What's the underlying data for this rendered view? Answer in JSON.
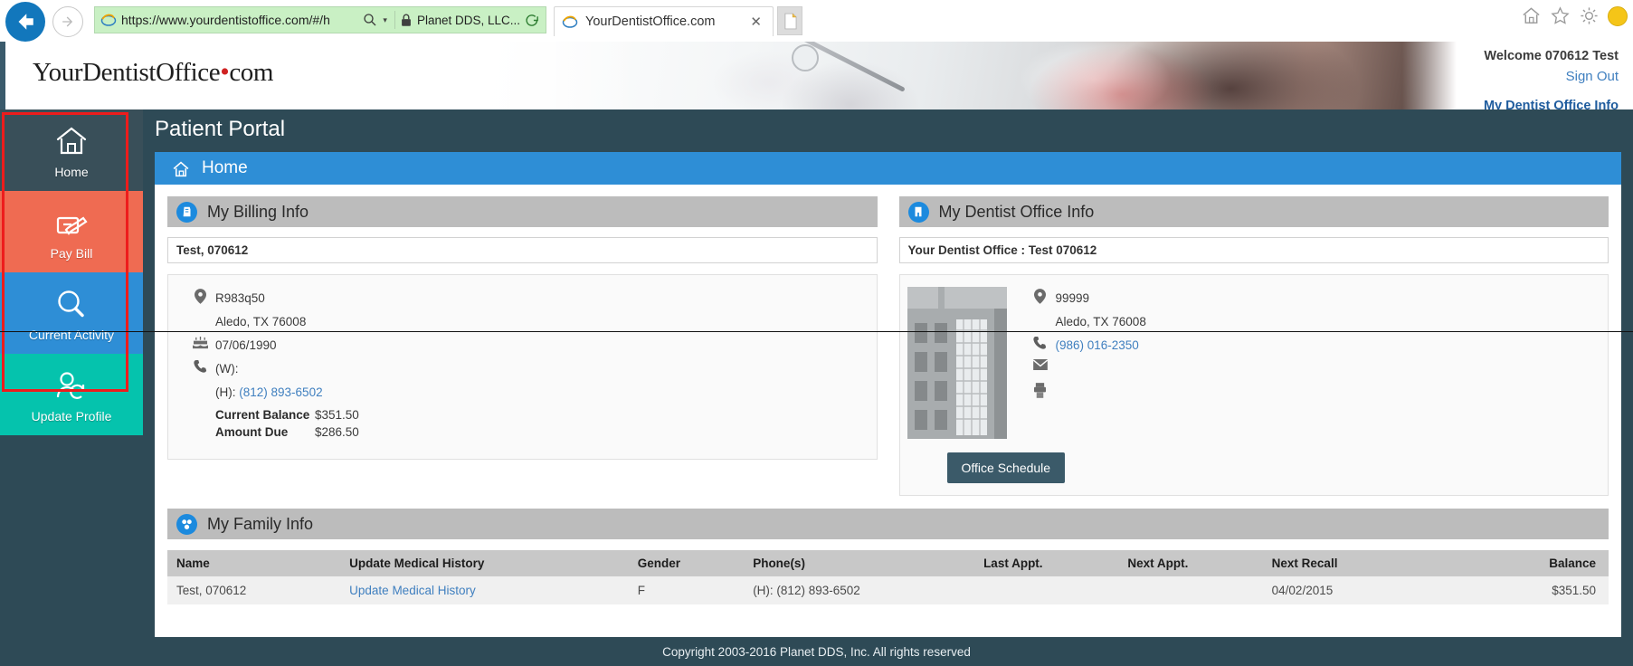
{
  "browser": {
    "back_icon": "back-arrow-icon",
    "forward_icon": "forward-arrow-icon",
    "url": "https://www.yourdentistoffice.com/#/h",
    "url_prefix": "https://www.",
    "url_domain": "yourdentistoffice.com",
    "url_path": "/#/h",
    "search_icon": "search-icon",
    "dropdown_caret": "▾",
    "lock_icon": "lock-icon",
    "cert_name": "Planet DDS, LLC...",
    "refresh_icon": "refresh-icon",
    "tab_title": "YourDentistOffice.com",
    "tab_close": "✕",
    "new_tab_icon": "new-tab-icon",
    "home_icon": "home-icon",
    "favorites_icon": "star-icon",
    "settings_icon": "gear-icon"
  },
  "header": {
    "logo_part1": "YourDentistOffice",
    "logo_dot": "•",
    "logo_part2": "com",
    "welcome": "Welcome 070612 Test",
    "sign_out": "Sign Out",
    "my_dentist_office_info": "My Dentist Office Info",
    "banner_alt": "dental-exam-banner-image"
  },
  "sidebar": {
    "items": [
      {
        "label": "Home",
        "icon": "house-icon",
        "color": "#394f59"
      },
      {
        "label": "Pay Bill",
        "icon": "payment-card-icon",
        "color": "#ef6b52"
      },
      {
        "label": "Current Activity",
        "icon": "magnifier-icon",
        "color": "#2e8ed6"
      },
      {
        "label": "Update Profile",
        "icon": "user-refresh-icon",
        "color": "#05c3ad"
      }
    ],
    "highlight_color": "#ee1c1c"
  },
  "main": {
    "page_title": "Patient Portal",
    "breadcrumb": {
      "icon": "house-icon",
      "label": "Home",
      "color": "#2e8ed6"
    },
    "billing": {
      "panel_title": "My Billing Info",
      "panel_icon": "billing-badge-icon",
      "patient_name": "Test, 070612",
      "address_icon": "location-pin-icon",
      "address_line1": "R983q50",
      "address_line2": "Aledo, TX 76008",
      "birthday_icon": "birthday-cake-icon",
      "birthdate": "07/06/1990",
      "phone_icon": "phone-icon",
      "work_phone_label": "(W):",
      "work_phone": "",
      "home_phone_label": "(H):",
      "home_phone": "(812) 893-6502",
      "current_balance_label": "Current Balance",
      "current_balance": "$351.50",
      "amount_due_label": "Amount Due",
      "amount_due": "$286.50"
    },
    "office": {
      "panel_title": "My Dentist Office Info",
      "panel_icon": "office-badge-icon",
      "office_name": "Your Dentist Office : Test 070612",
      "building_image": "office-building-illustration",
      "address_icon": "location-pin-icon",
      "address_line1": "99999",
      "address_line2": "Aledo, TX 76008",
      "phone_icon": "phone-icon",
      "phone": "(986) 016-2350",
      "email_icon": "envelope-icon",
      "email": "",
      "fax_icon": "fax-icon",
      "fax": "",
      "schedule_button": "Office Schedule"
    },
    "family": {
      "panel_title": "My Family Info",
      "panel_icon": "family-badge-icon",
      "columns": [
        "Name",
        "Update Medical History",
        "Gender",
        "Phone(s)",
        "Last Appt.",
        "Next Appt.",
        "Next Recall",
        "Balance"
      ],
      "rows": [
        {
          "name": "Test, 070612",
          "update_medical_history": "Update Medical History",
          "gender": "F",
          "phones": "(H): (812) 893-6502",
          "last_appt": "",
          "next_appt": "",
          "next_recall": "04/02/2015",
          "balance": "$351.50"
        }
      ]
    }
  },
  "footer": {
    "copyright": "Copyright 2003-2016 Planet DDS, Inc. All rights reserved"
  }
}
